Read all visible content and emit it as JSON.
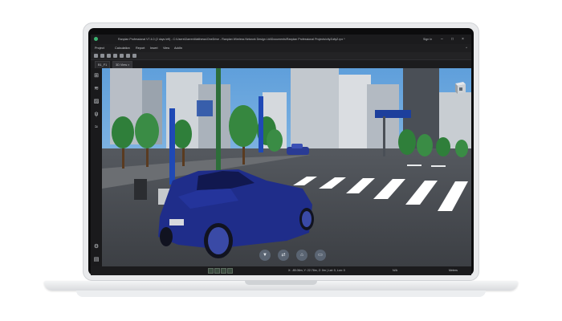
{
  "window": {
    "title": "Ranplan Professional V7.4.0 (2 days left) - C:\\Users\\DarrenMatthews\\OneDrive - Ranplan Wireless Network Design Ltd\\Documents\\Ranplan Professional Projects\\cityZuity2.rpx *",
    "sign_in": "Sign In"
  },
  "menu": [
    "Project",
    "Calculation",
    "Report",
    "Insert",
    "View",
    "AddIn"
  ],
  "tabs": [
    "B1_F1",
    "3D View"
  ],
  "status": {
    "coords": "X: -85.06m, Y: 22.78m, Z: 0m | Lat: 0, Lon: 0",
    "na": "N/A",
    "units": "Meters"
  },
  "icons": {
    "sidebar_top": [
      "network-icon",
      "layers-icon",
      "hatch-icon",
      "antenna-icon",
      "signal-icon"
    ],
    "sidebar_bottom": [
      "settings-icon",
      "document-icon"
    ],
    "nav": [
      "down-arrow-icon",
      "swap-icon",
      "home-icon",
      "camera-icon"
    ]
  },
  "colors": {
    "logo": "#3cb371",
    "car": "#1f2d8a",
    "sky": "#6fa9dd",
    "tree": "#2f7f3a"
  }
}
